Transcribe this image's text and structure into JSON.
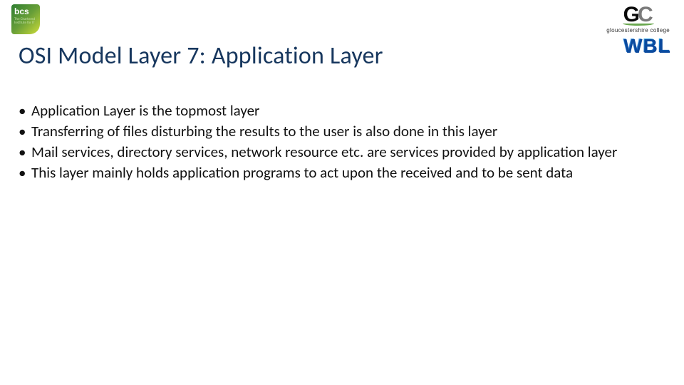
{
  "logos": {
    "bcs": {
      "text": "bcs",
      "sub": "The Chartered Institute for IT"
    },
    "gc": {
      "g": "G",
      "c": "C",
      "label": "gloucestershire college"
    },
    "wbl": {
      "w": "W",
      "b": "B",
      "l": "L"
    }
  },
  "title": "OSI Model Layer 7: Application Layer",
  "bullets": [
    "Application Layer is the topmost layer",
    "Transferring of files disturbing the results to the user is also done in this layer",
    "Mail services, directory services, network resource etc. are services provided by application layer",
    "This layer mainly holds application programs to act upon the received and to be sent data"
  ]
}
